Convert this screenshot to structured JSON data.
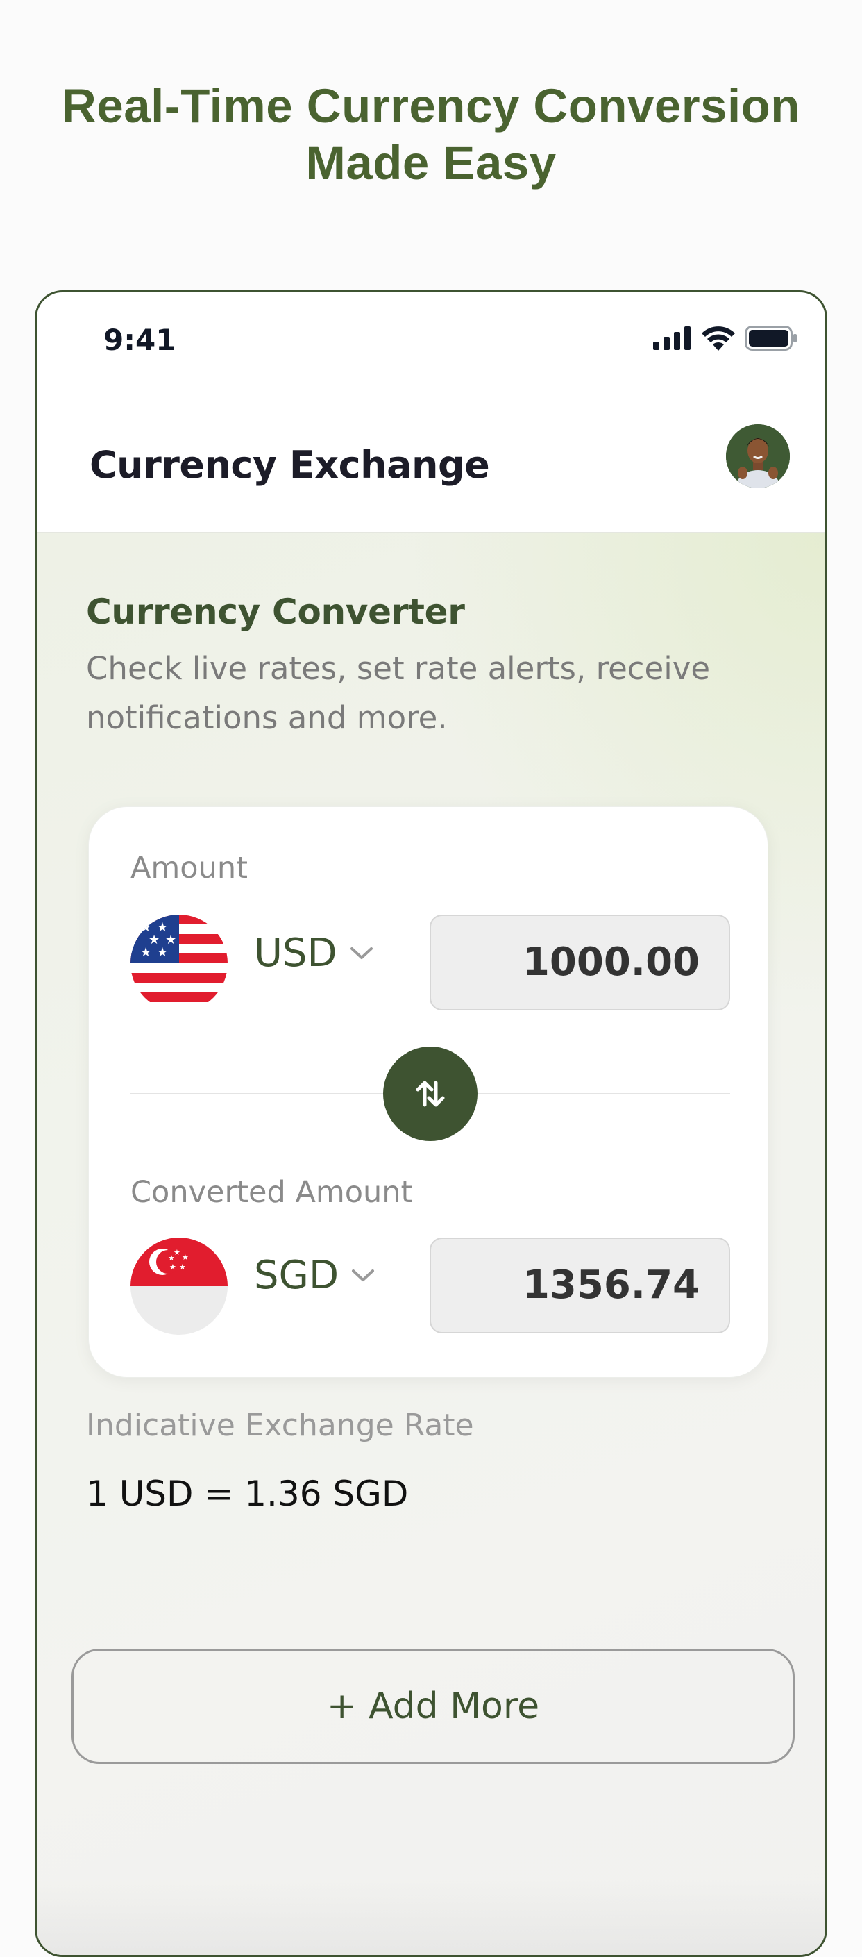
{
  "headline": {
    "line1": "Real-Time Currency Conversion",
    "line2": "Made Easy"
  },
  "status_bar": {
    "time": "9:41",
    "icons": [
      "cellular-signal-icon",
      "wifi-icon",
      "battery-icon"
    ]
  },
  "app_bar": {
    "title": "Currency Exchange",
    "avatar": "user-avatar"
  },
  "converter": {
    "title": "Currency Converter",
    "description": "Check live rates, set rate alerts, receive notifications and more.",
    "amount_label": "Amount",
    "from_currency": "USD",
    "from_amount": "1000.00",
    "converted_label": "Converted Amount",
    "to_currency": "SGD",
    "to_amount": "1356.74",
    "swap_icon": "swap-arrows-icon"
  },
  "rate": {
    "label": "Indicative Exchange Rate",
    "value": "1 USD = 1.36 SGD"
  },
  "add_more": {
    "label": "+ Add More"
  },
  "colors": {
    "brand_green": "#3e5331",
    "headline_green": "#4a6330",
    "field_bg": "#eeeeee",
    "muted_text": "#8a8a8a"
  }
}
